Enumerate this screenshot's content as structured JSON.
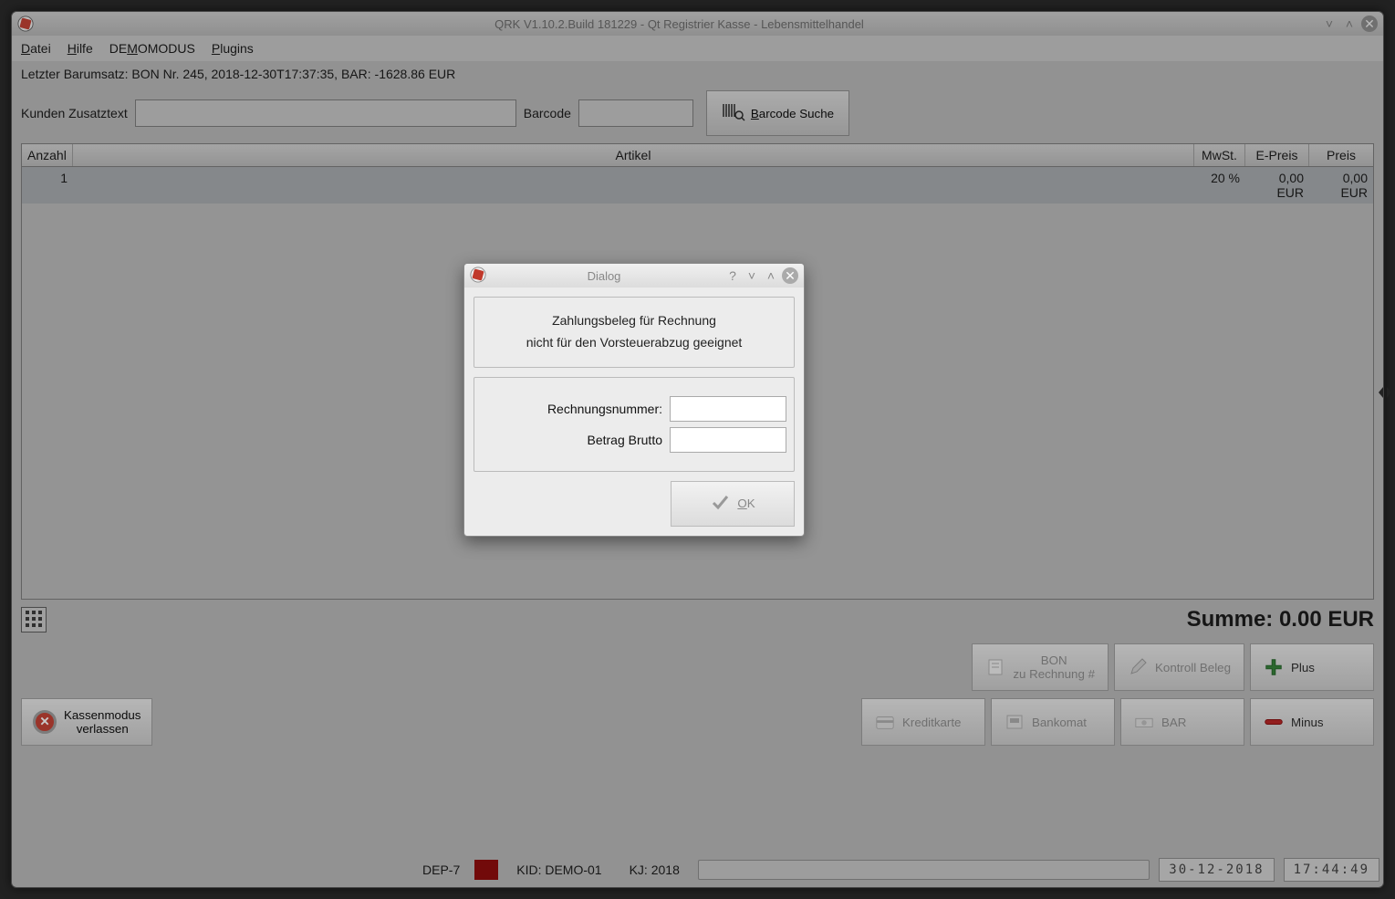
{
  "window": {
    "title": "QRK V1.10.2.Build 181229 - Qt Registrier Kasse - Lebensmittelhandel"
  },
  "menu": {
    "datei": "Datei",
    "hilfe": "Hilfe",
    "demomodus": "DEMOMODUS",
    "plugins": "Plugins"
  },
  "info": {
    "last_sale": "Letzter Barumsatz: BON Nr. 245, 2018-12-30T17:37:35, BAR: -1628.86 EUR"
  },
  "search": {
    "kunden_label": "Kunden Zusatztext",
    "kunden_value": "",
    "barcode_label": "Barcode",
    "barcode_value": "",
    "barcode_suche": "Barcode Suche"
  },
  "table": {
    "headers": {
      "anzahl": "Anzahl",
      "artikel": "Artikel",
      "mwst": "MwSt.",
      "epreis": "E-Preis",
      "preis": "Preis"
    },
    "rows": [
      {
        "anzahl": "1",
        "artikel": "",
        "mwst": "20 %",
        "epreis": "0,00 EUR",
        "preis": "0,00 EUR"
      }
    ]
  },
  "sum": {
    "label": "Summe: 0.00 EUR"
  },
  "buttons": {
    "bon_line1": "BON",
    "bon_line2": "zu Rechnung #",
    "kontroll": "Kontroll Beleg",
    "plus": "Plus",
    "kredit": "Kreditkarte",
    "bankomat": "Bankomat",
    "bar": "BAR",
    "minus": "Minus",
    "exit_line1": "Kassenmodus",
    "exit_line2": "verlassen"
  },
  "status": {
    "dep": "DEP-7",
    "kid": "KID: DEMO-01",
    "kj": "KJ: 2018",
    "date": "30-12-2018",
    "time": "17:44:49"
  },
  "dialog": {
    "title": "Dialog",
    "msg1": "Zahlungsbeleg für Rechnung",
    "msg2": "nicht für den Vorsteuerabzug geeignet",
    "rechnr_label": "Rechnungsnummer:",
    "rechnr_value": "",
    "brutto_label": "Betrag Brutto",
    "brutto_value": "",
    "ok": "OK"
  }
}
